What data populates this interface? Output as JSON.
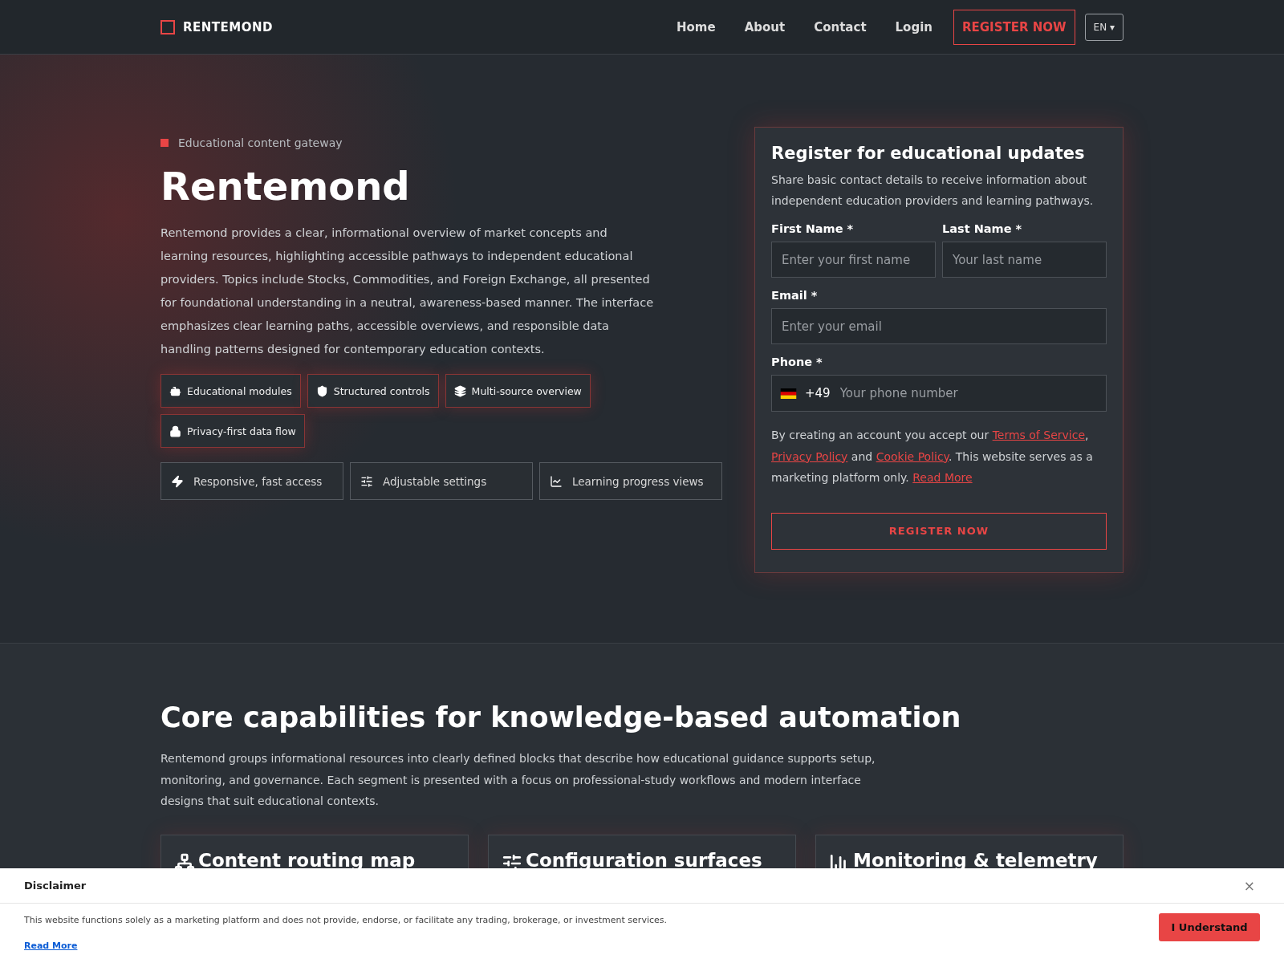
{
  "nav": {
    "brand": "RENTEMOND",
    "links": [
      "Home",
      "About",
      "Contact",
      "Login"
    ],
    "cta": "REGISTER NOW",
    "language": "EN ▾"
  },
  "hero": {
    "eyebrow": "Educational content gateway",
    "title": "Rentemond",
    "description": "Rentemond provides a clear, informational overview of market concepts and learning resources, highlighting accessible pathways to independent educational providers. Topics include Stocks, Commodities, and Foreign Exchange, all presented for foundational understanding in a neutral, awareness-based manner. The interface emphasizes clear learning paths, accessible overviews, and responsible data handling patterns designed for contemporary education contexts.",
    "highlights": [
      "Educational modules",
      "Structured controls",
      "Multi-source overview",
      "Privacy-first data flow"
    ],
    "features": [
      "Responsive, fast access",
      "Adjustable settings",
      "Learning progress views"
    ]
  },
  "form": {
    "title": "Register for educational updates",
    "subtitle": "Share basic contact details to receive information about independent education providers and learning pathways.",
    "first_name": {
      "label": "First Name *",
      "placeholder": "Enter your first name"
    },
    "last_name": {
      "label": "Last Name *",
      "placeholder": "Your last name"
    },
    "email": {
      "label": "Email *",
      "placeholder": "Enter your email"
    },
    "phone": {
      "label": "Phone *",
      "code": "+49",
      "placeholder": "Your phone number"
    },
    "consent": [
      {
        "kind": "text",
        "text": "By creating an account you accept our "
      },
      {
        "kind": "link",
        "text": "Terms of Service"
      },
      {
        "kind": "text",
        "text": ", "
      },
      {
        "kind": "link",
        "text": "Privacy Policy"
      },
      {
        "kind": "text",
        "text": " and "
      },
      {
        "kind": "link",
        "text": "Cookie Policy"
      },
      {
        "kind": "text",
        "text": ". This website serves as a marketing platform only. "
      },
      {
        "kind": "link",
        "text": "Read More"
      }
    ],
    "submit": "REGISTER NOW"
  },
  "capabilities": {
    "title": "Core capabilities for knowledge-based automation",
    "description": "Rentemond groups informational resources into clearly defined blocks that describe how educational guidance supports setup, monitoring, and governance. Each segment is presented with a focus on professional-study workflows and modern interface designs that suit educational contexts.",
    "cards": [
      {
        "title": "Content routing map"
      },
      {
        "title": "Configuration surfaces"
      },
      {
        "title": "Monitoring & telemetry"
      }
    ]
  },
  "disclaimer": {
    "title": "Disclaimer",
    "close": "×",
    "text": "This website functions solely as a marketing platform and does not provide, endorse, or facilitate any trading, brokerage, or investment services.",
    "link": "Read More",
    "button": "I Understand"
  }
}
